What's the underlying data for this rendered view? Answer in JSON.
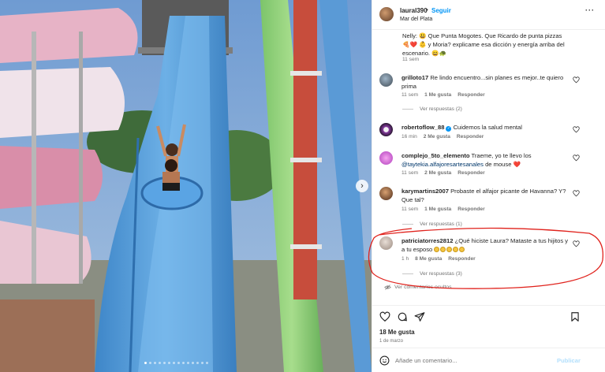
{
  "header": {
    "username": "laural390",
    "separator": "•",
    "follow_label": "Seguir",
    "location": "Mar del Plata",
    "more": "···"
  },
  "comments": [
    {
      "username": "",
      "text": "Nelly: 😃 Que Punta Mogotes. Que Ricardo de punta pizzas 🍕❤️ 👶 y Moria? explicame esa dicción y energía arriba del escenario. 😄🐢",
      "time": "11 sem"
    },
    {
      "username": "grilloto17",
      "text": "Re lindo encuentro...sin planes es mejor..te quiero prima",
      "time": "11 sem",
      "likes": "1 Me gusta",
      "reply": "Responder",
      "view_replies": "Ver respuestas (2)"
    },
    {
      "username": "robertoflow_88",
      "text": "Cuidemos la salud mental",
      "time": "16 min",
      "likes": "2 Me gusta",
      "reply": "Responder"
    },
    {
      "username": "complejo_5to_elemento",
      "text": "Traeme, yo te llevo los",
      "mention": "@taytekia.alfajoresartesanales",
      "text_after": "de mouse ❤️",
      "time": "11 sem",
      "likes": "2 Me gusta",
      "reply": "Responder"
    },
    {
      "username": "karymartins2007",
      "text": "Probaste el alfajor picante de Havanna? Y? Que tal?",
      "time": "11 sem",
      "likes": "1 Me gusta",
      "reply": "Responder",
      "view_replies": "Ver respuestas (1)"
    },
    {
      "username": "patriciatorres2812",
      "text": "¿Qué hiciste Laura? Mataste a tus hijitos y a tu esposo",
      "time": "1 h",
      "likes": "8 Me gusta",
      "reply": "Responder",
      "view_replies": "Ver respuestas (3)"
    }
  ],
  "hidden_comments": "Ver comentarios ocultos",
  "post": {
    "likes": "18 Me gusta",
    "date": "1 de marzo"
  },
  "composer": {
    "placeholder": "Añade un comentario...",
    "publish_label": "Publicar"
  },
  "colors": {
    "accent": "#0095f6",
    "highlight_oval": "#e0221c",
    "mention": "#00376b"
  }
}
